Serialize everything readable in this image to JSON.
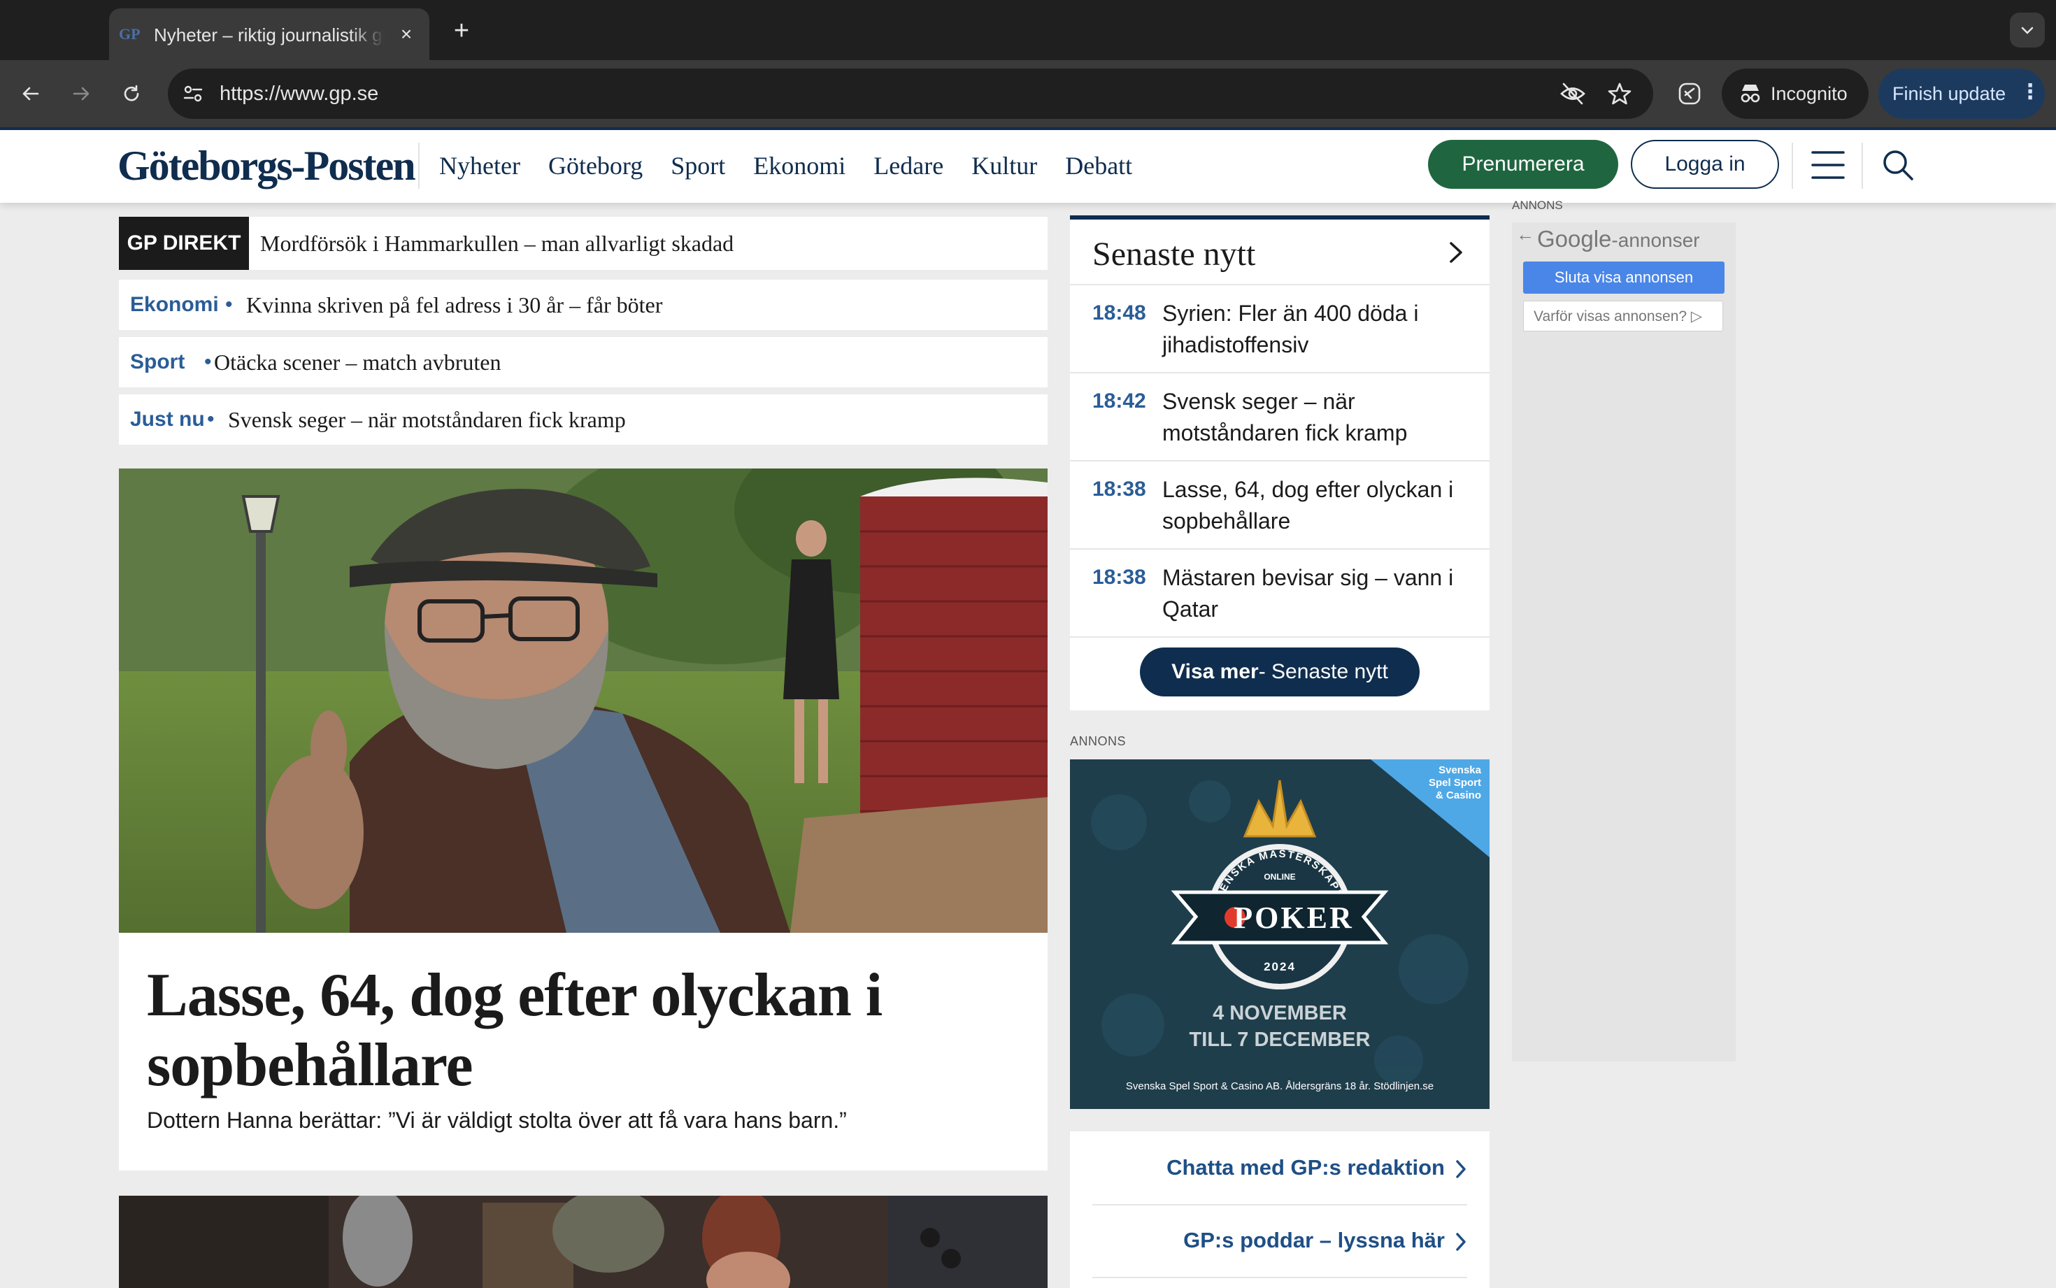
{
  "browser": {
    "tab_title": "Nyheter – riktig journalistik gp",
    "tab_favicon": "GP",
    "tab_close": "×",
    "new_tab": "+",
    "url": "https://www.gp.se",
    "incognito_label": "Incognito",
    "finish_update_label": "Finish update",
    "menu_dots": "⋮"
  },
  "site": {
    "logo": "Göteborgs-Posten",
    "nav": [
      "Nyheter",
      "Göteborg",
      "Sport",
      "Ekonomi",
      "Ledare",
      "Kultur",
      "Debatt"
    ],
    "subscribe_label": "Prenumerera",
    "login_label": "Logga in"
  },
  "ticker": {
    "direkt_badge": "GP DIREKT",
    "direkt_text": "Mordförsök i Hammarkullen – man allvarligt skadad",
    "items": [
      {
        "category": "Ekonomi",
        "text": "Kvinna skriven på fel adress i 30 år – får böter"
      },
      {
        "category": "Sport",
        "text": "Otäcka scener – match avbruten"
      },
      {
        "category": "Just nu",
        "text": "Svensk seger – när motståndaren fick kramp"
      }
    ],
    "separator": "•"
  },
  "hero": {
    "title": "Lasse, 64, dog efter olyckan i sopbehållare",
    "subtitle": "Dottern Hanna berättar: ”Vi är väldigt stolta över att få vara hans barn.”"
  },
  "latest": {
    "heading": "Senaste nytt",
    "items": [
      {
        "time": "18:48",
        "text": "Syrien: Fler än 400 döda i jihadistoffensiv"
      },
      {
        "time": "18:42",
        "text": "Svensk seger – när motståndaren fick kramp"
      },
      {
        "time": "18:38",
        "text": "Lasse, 64, dog efter olyckan i sopbehållare"
      },
      {
        "time": "18:38",
        "text": "Mästaren bevisar sig – vann i Qatar"
      }
    ],
    "more_bold": "Visa mer",
    "more_rest": "- Senaste nytt"
  },
  "ads": {
    "annons_label": "ANNONS",
    "poker": {
      "corner": [
        "Svenska",
        "Spel Sport",
        "& Casino"
      ],
      "arc_text": "SVENSKA MÄSTERSKAPEN",
      "online": "ONLINE",
      "word": "POKER",
      "year": "2024",
      "date_line1": "4 NOVEMBER",
      "date_line2": "TILL 7 DECEMBER",
      "footer": "Svenska Spel Sport & Casino AB. Åldersgräns 18 år. Stödlinjen.se"
    },
    "google": {
      "annons_label": "ANNONS",
      "brand": "Google",
      "brand_suffix": "-annonser",
      "stop_label": "Sluta visa annonsen",
      "why_label": "Varför visas annonsen? ▷"
    }
  },
  "links": [
    {
      "label": "Chatta med GP:s redaktion"
    },
    {
      "label": "GP:s poddar – lyssna här"
    }
  ]
}
